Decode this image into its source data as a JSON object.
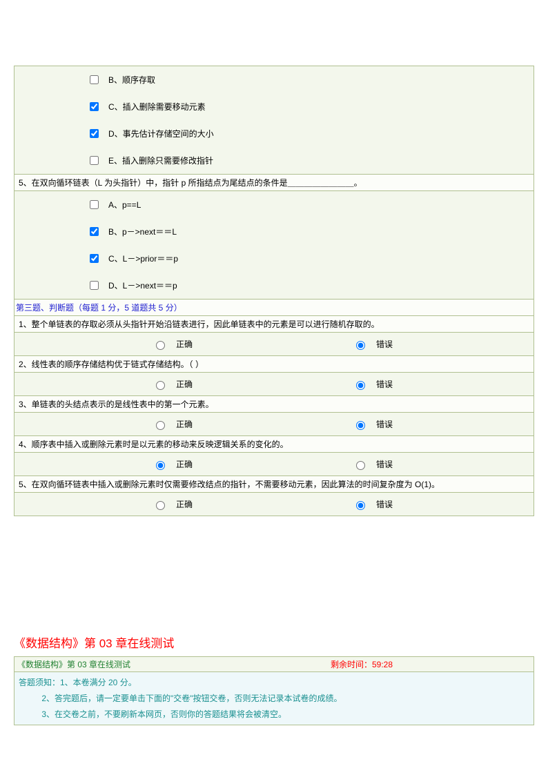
{
  "panel1": {
    "optionsA": [
      {
        "label": "B、顺序存取",
        "checked": false
      },
      {
        "label": "C、插入删除需要移动元素",
        "checked": true
      },
      {
        "label": "D、事先估计存储空间的大小",
        "checked": true
      },
      {
        "label": "E、插入删除只需要修改指针",
        "checked": false
      }
    ],
    "question5": "5、在双向循环链表（L 为头指针）中，指针 p 所指结点为尾结点的条件是＿＿＿＿＿＿＿＿。",
    "optionsB": [
      {
        "label": "A、p==L",
        "checked": false
      },
      {
        "label": "B、p－>next＝＝L",
        "checked": true
      },
      {
        "label": "C、L－>prior＝＝p",
        "checked": true
      },
      {
        "label": "D、L－>next＝＝p",
        "checked": false
      }
    ],
    "section3_header": "第三题、判断题（每题 1 分，5 道题共 5 分）",
    "tf_true": "正确",
    "tf_false": "错误",
    "tf": [
      {
        "q": "1、整个单链表的存取必须从头指针开始沿链表进行，因此单链表中的元素是可以进行随机存取的。",
        "ans": "false"
      },
      {
        "q": "2、线性表的顺序存储结构优于链式存储结构。（ ）",
        "ans": "false"
      },
      {
        "q": "3、单链表的头结点表示的是线性表中的第一个元素。",
        "ans": "false"
      },
      {
        "q": "4、顺序表中插入或删除元素时是以元素的移动来反映逻辑关系的变化的。",
        "ans": "true"
      },
      {
        "q": "5、在双向循环链表中插入或删除元素时仅需要修改结点的指针，不需要移动元素，因此算法的时间复杂度为 O(1)。",
        "ans": "false"
      }
    ]
  },
  "bottom": {
    "title": "《数据结构》第 03 章在线测试",
    "timer_left": "《数据结构》第 03 章在线测试",
    "timer_right": "剩余时间：59:28",
    "notice1": "答题须知：1、本卷满分 20 分。",
    "notice2": "          2、答完题后，请一定要单击下面的\"交卷\"按钮交卷，否则无法记录本试卷的成绩。",
    "notice3": "          3、在交卷之前，不要刷新本网页，否则你的答题结果将会被清空。"
  }
}
